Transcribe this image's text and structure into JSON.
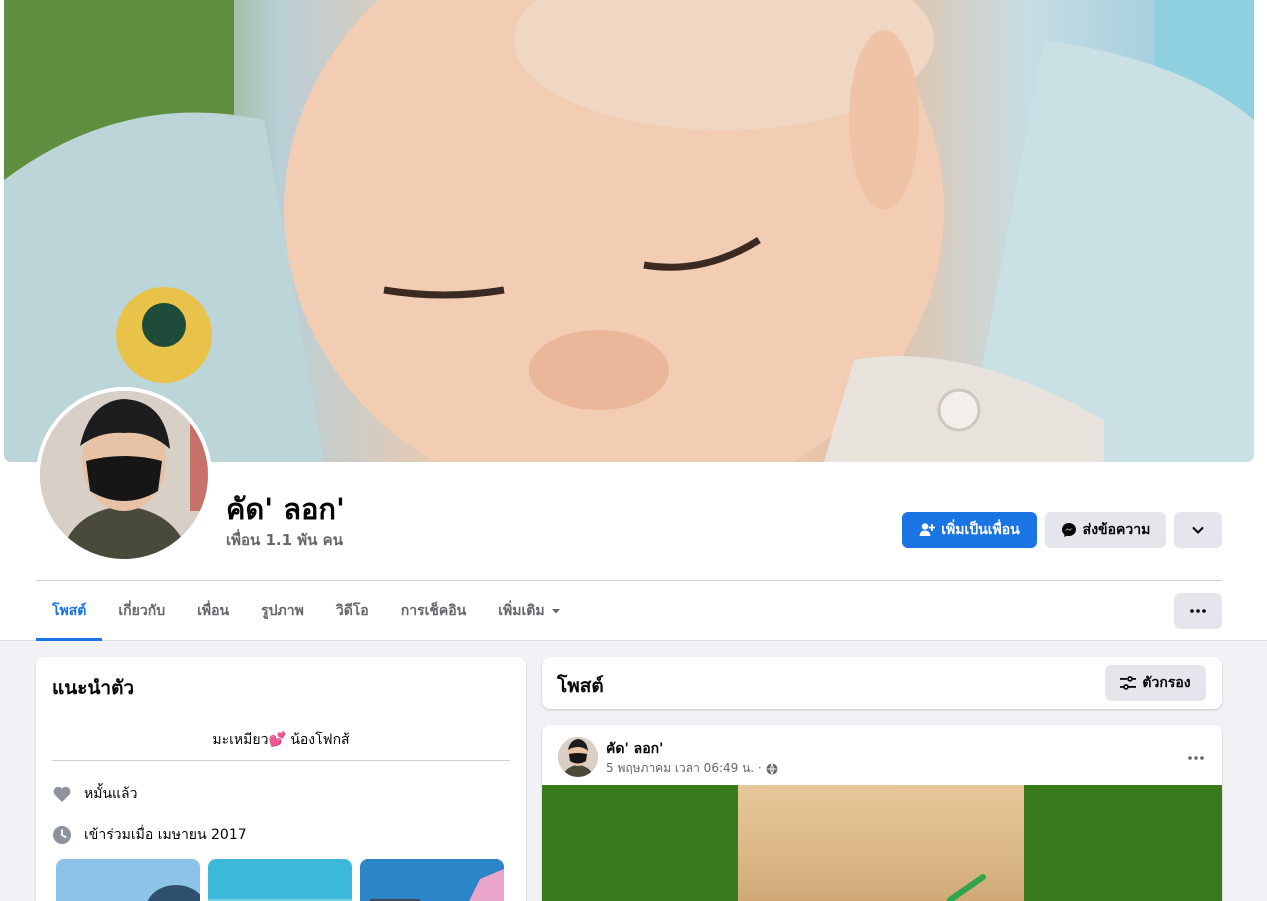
{
  "profile": {
    "name": "คัด' ลอก'",
    "friends": "เพื่อน 1.1 พัน คน"
  },
  "actions": {
    "add_friend": "เพิ่มเป็นเพื่อน",
    "message": "ส่งข้อความ"
  },
  "tabs": [
    {
      "label": "โพสต์",
      "active": true
    },
    {
      "label": "เกี่ยวกับ",
      "active": false
    },
    {
      "label": "เพื่อน",
      "active": false
    },
    {
      "label": "รูปภาพ",
      "active": false
    },
    {
      "label": "วิดีโอ",
      "active": false
    },
    {
      "label": "การเช็คอิน",
      "active": false
    },
    {
      "label": "เพิ่มเติม",
      "active": false
    }
  ],
  "intro": {
    "title": "แนะนำตัว",
    "bio_prefix": "มะเหมียว",
    "bio_emoji": "💕",
    "bio_suffix": "น้องโฟกส้",
    "relationship": "หมั้นแล้ว",
    "joined": "เข้าร่วมเมื่อ เมษายน 2017"
  },
  "posts": {
    "title": "โพสต์",
    "filter_label": "ตัวกรอง",
    "items": [
      {
        "author": "คัด' ลอก'",
        "timestamp": "5 พฤษภาคม เวลา 06:49 น. ·"
      }
    ]
  },
  "colors": {
    "accent": "#1b74e4",
    "secondary_button": "#e4e6eb",
    "page_background": "#f0f2f5"
  },
  "icons": [
    "add-friend-icon",
    "messenger-icon",
    "chevron-down-icon",
    "more-dots-icon",
    "heart-icon",
    "clock-icon",
    "filter-icon",
    "globe-icon",
    "caret-down-icon"
  ]
}
